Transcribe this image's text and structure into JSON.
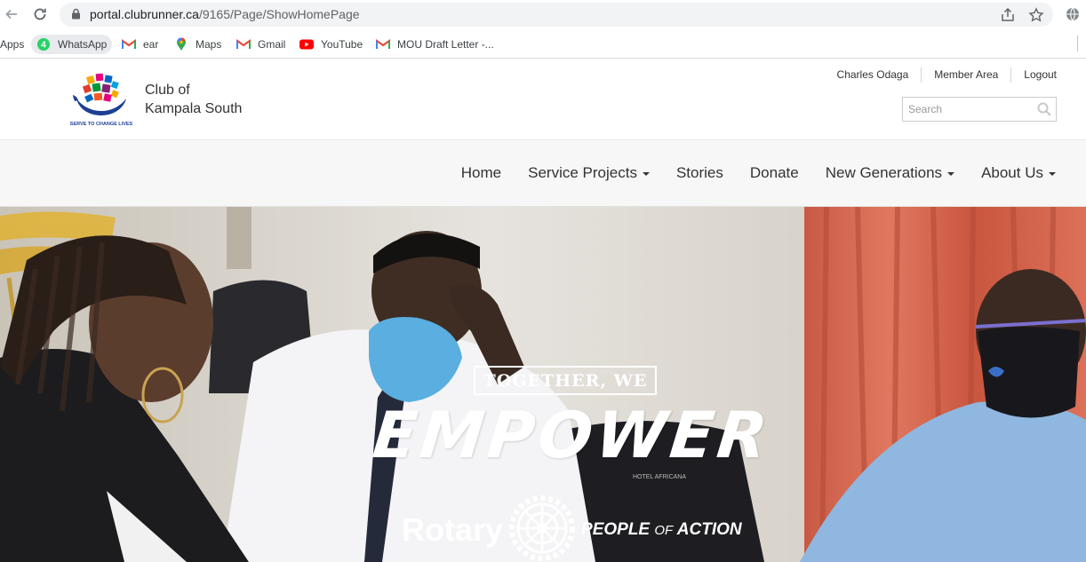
{
  "browser": {
    "url_host": "portal.clubrunner.ca",
    "url_path": "/9165/Page/ShowHomePage",
    "bookmarks": [
      {
        "label": "Apps",
        "icon": "apps-grid-icon"
      },
      {
        "label": "WhatsApp",
        "icon": "whatsapp-icon"
      },
      {
        "label": "ear",
        "icon": "gmail-icon"
      },
      {
        "label": "Maps",
        "icon": "maps-icon"
      },
      {
        "label": "Gmail",
        "icon": "gmail-icon"
      },
      {
        "label": "YouTube",
        "icon": "youtube-icon"
      },
      {
        "label": "MOU Draft Letter -...",
        "icon": "gmail-icon"
      }
    ],
    "whatsapp_badge": "4"
  },
  "header": {
    "club_line1": "Club of",
    "club_line2": "Kampala South",
    "logo_tagline": "SERVE TO CHANGE LIVES",
    "util_links": [
      "Charles Odaga",
      "Member Area",
      "Logout"
    ],
    "search_placeholder": "Search"
  },
  "nav": {
    "items": [
      {
        "label": "Home",
        "dropdown": false
      },
      {
        "label": "Service Projects",
        "dropdown": true
      },
      {
        "label": "Stories",
        "dropdown": false
      },
      {
        "label": "Donate",
        "dropdown": false
      },
      {
        "label": "New Generations",
        "dropdown": true
      },
      {
        "label": "About Us",
        "dropdown": true
      }
    ]
  },
  "hero": {
    "badge_text": "TOGETHER, WE",
    "headline": "EMPOWER",
    "brand": "Rotary",
    "slogan_a": "PEOPLE ",
    "slogan_of": "OF",
    "slogan_b": " ACTION",
    "table_card": "HOTEL AFRICANA"
  },
  "colors": {
    "omnibox_bg": "#f1f3f4",
    "nav_bg": "#f7f7f8",
    "text": "#333333",
    "curtain": "#d6634c"
  }
}
